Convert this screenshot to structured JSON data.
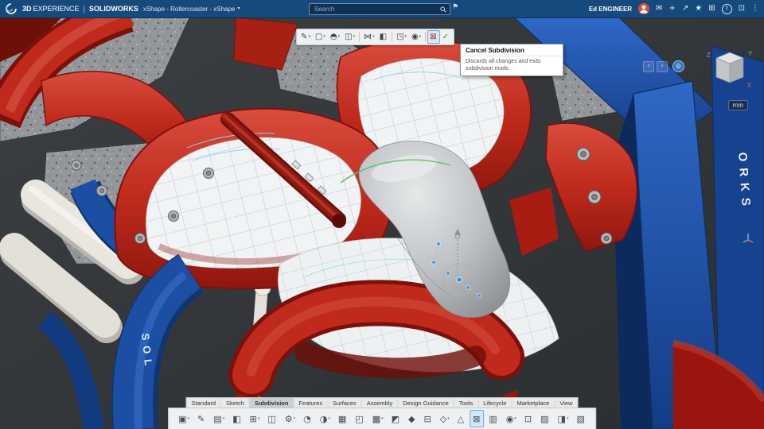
{
  "topbar": {
    "brand_bold": "3D",
    "brand_light": "EXPERIENCE",
    "pipe": "|",
    "product": "SOLIDWORKS",
    "app_title": "xShape - Rollercoaster - xShape",
    "caret": "▾",
    "search_placeholder": "Search",
    "user_name": "Ed ENGINEER",
    "icons": [
      {
        "name": "share-icon",
        "glyph": "✉"
      },
      {
        "name": "add-icon",
        "glyph": "+"
      },
      {
        "name": "open-share-icon",
        "glyph": "↗"
      },
      {
        "name": "favorites-icon",
        "glyph": "★"
      },
      {
        "name": "apps-grid-icon",
        "glyph": "⊞"
      },
      {
        "name": "help-icon",
        "glyph": "?",
        "cls": "ring"
      },
      {
        "name": "widget-icon",
        "glyph": "⊡"
      },
      {
        "name": "more-options-icon",
        "glyph": "⋮"
      }
    ]
  },
  "toolbar": {
    "buttons": [
      {
        "name": "freestyle-button",
        "glyph": "✎",
        "caret": "▾"
      },
      {
        "name": "primitive-box-button",
        "glyph": "▢",
        "caret": "▾"
      },
      {
        "name": "primitive-sphere-button",
        "glyph": "◓",
        "caret": "▾"
      },
      {
        "name": "primitive-cylinder-button",
        "glyph": "◫",
        "caret": "▾"
      },
      {
        "sep": true
      },
      {
        "name": "symmetry-button",
        "glyph": "⋈",
        "caret": "▾"
      },
      {
        "name": "mirror-button",
        "glyph": "◧",
        "caret": ""
      },
      {
        "sep": true
      },
      {
        "name": "display-mode-button",
        "glyph": "◳",
        "caret": "▾"
      },
      {
        "name": "visibility-button",
        "glyph": "◉",
        "caret": "▾"
      },
      {
        "sep": true
      },
      {
        "name": "cancel-subdivision-button",
        "glyph": "⊠",
        "caret": "",
        "active": true,
        "color": "#b3261e"
      },
      {
        "name": "confirm-subdivision-button",
        "glyph": "✓",
        "caret": "",
        "color": "#1e8e3e"
      }
    ]
  },
  "tooltip": {
    "title": "Cancel Subdivision",
    "body": "Discards all changes and exits subdivision mode."
  },
  "viewnav": {
    "prev": "‹",
    "next": "›",
    "badge": "◎"
  },
  "viewcube": {
    "x": "X",
    "y": "Y",
    "z": "Z",
    "unit": "mm"
  },
  "scene": {
    "decal_left": "SOL",
    "decal_right": "ORKS"
  },
  "tabs": [
    {
      "name": "tab-standard",
      "label": "Standard"
    },
    {
      "name": "tab-sketch",
      "label": "Sketch"
    },
    {
      "name": "tab-subdivision",
      "label": "Subdivision",
      "active": true
    },
    {
      "name": "tab-features",
      "label": "Features"
    },
    {
      "name": "tab-surfaces",
      "label": "Surfaces"
    },
    {
      "name": "tab-assembly",
      "label": "Assembly"
    },
    {
      "name": "tab-design-guidance",
      "label": "Design Guidance"
    },
    {
      "name": "tab-tools",
      "label": "Tools"
    },
    {
      "name": "tab-lifecycle",
      "label": "Lifecycle"
    },
    {
      "name": "tab-marketplace",
      "label": "Marketplace"
    },
    {
      "name": "tab-view",
      "label": "View"
    }
  ],
  "bottom_icons": [
    {
      "name": "select-tool-icon",
      "glyph": "▣",
      "caret": "▾"
    },
    {
      "name": "sketch-tool-icon",
      "glyph": "✎",
      "caret": ""
    },
    {
      "name": "extrude-tool-icon",
      "glyph": "▤",
      "caret": "▾"
    },
    {
      "name": "revolve-tool-icon",
      "glyph": "◧",
      "caret": ""
    },
    {
      "name": "pattern-tool-icon",
      "glyph": "⊞",
      "caret": "▾"
    },
    {
      "name": "mirror-tool-icon",
      "glyph": "◫",
      "caret": ""
    },
    {
      "name": "settings-tool-icon",
      "glyph": "⚙",
      "caret": "▾"
    },
    {
      "name": "measure-tool-icon",
      "glyph": "◔",
      "caret": ""
    },
    {
      "name": "section-tool-icon",
      "glyph": "◑",
      "caret": "▾"
    },
    {
      "name": "mesh-tool-icon",
      "glyph": "▦",
      "caret": ""
    },
    {
      "name": "frame-tool-icon",
      "glyph": "◰",
      "caret": ""
    },
    {
      "name": "appearance-tool-icon",
      "glyph": "▩",
      "caret": "▾"
    },
    {
      "name": "material-tool-icon",
      "glyph": "◩",
      "caret": ""
    },
    {
      "name": "mate-tool-icon",
      "glyph": "◆",
      "caret": ""
    },
    {
      "name": "boolean-tool-icon",
      "glyph": "⊟",
      "caret": ""
    },
    {
      "name": "spline-tool-icon",
      "glyph": "◇",
      "caret": "▾"
    },
    {
      "name": "triangle-tool-icon",
      "glyph": "△",
      "caret": ""
    },
    {
      "name": "subdivision-tool-icon",
      "glyph": "⊠",
      "caret": "",
      "active": true
    },
    {
      "name": "grid-tool-icon",
      "glyph": "▥",
      "caret": ""
    },
    {
      "name": "visibility-tool-icon",
      "glyph": "◉",
      "caret": "▾"
    },
    {
      "name": "box-select-tool-icon",
      "glyph": "⊡",
      "caret": ""
    },
    {
      "name": "hatch-tool-icon",
      "glyph": "▨",
      "caret": ""
    },
    {
      "name": "shell-tool-icon",
      "glyph": "◨",
      "caret": "▾"
    },
    {
      "name": "surface-tool-icon",
      "glyph": "▧",
      "caret": ""
    }
  ],
  "colors": {
    "topbar": "#164a7c",
    "accent": "#2e8fe0",
    "model_red": "#bf2a1c",
    "model_blue": "#1c4fa3",
    "toolbar_bg": "#eef0f2",
    "active_tool_bg": "#d7e8f8"
  }
}
